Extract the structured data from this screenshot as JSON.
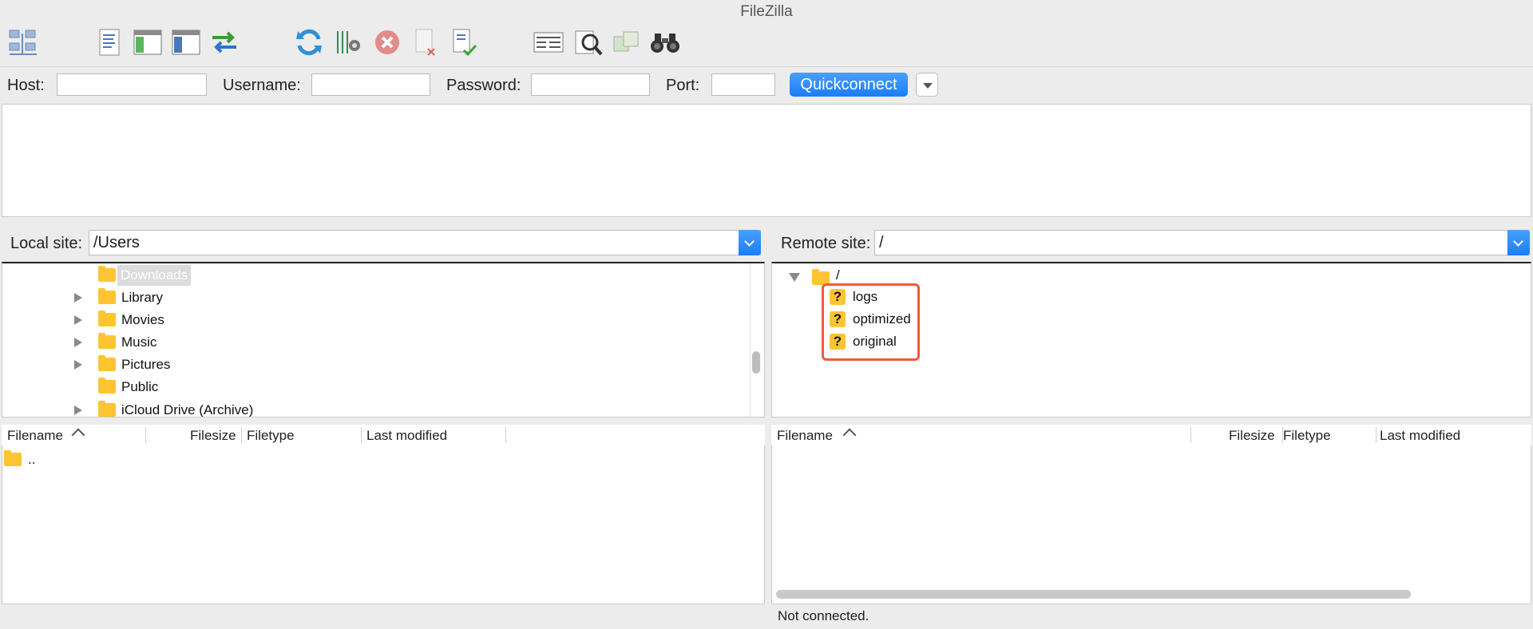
{
  "window": {
    "title": "FileZilla"
  },
  "toolbar": {
    "buttons": [
      {
        "name": "site-manager"
      },
      {
        "name": "toggle-message-log"
      },
      {
        "name": "toggle-local-tree"
      },
      {
        "name": "toggle-remote-tree"
      },
      {
        "name": "toggle-transfer-queue"
      },
      {
        "name": "refresh"
      },
      {
        "name": "process-queue"
      },
      {
        "name": "cancel-operation"
      },
      {
        "name": "disconnect"
      },
      {
        "name": "reconnect"
      },
      {
        "name": "directory-listing-filters"
      },
      {
        "name": "toggle-filename-filters"
      },
      {
        "name": "synchronized-browsing"
      },
      {
        "name": "search-remote-files"
      }
    ]
  },
  "quickconnect": {
    "host_label": "Host:",
    "host_value": "",
    "username_label": "Username:",
    "username_value": "",
    "password_label": "Password:",
    "password_value": "",
    "port_label": "Port:",
    "port_value": "",
    "button_label": "Quickconnect"
  },
  "local": {
    "site_label": "Local site:",
    "site_path": "/Users",
    "tree": [
      {
        "label": "Downloads",
        "expandable": false,
        "selected": true
      },
      {
        "label": "Library",
        "expandable": true
      },
      {
        "label": "Movies",
        "expandable": true
      },
      {
        "label": "Music",
        "expandable": true
      },
      {
        "label": "Pictures",
        "expandable": true
      },
      {
        "label": "Public",
        "expandable": false
      },
      {
        "label": "iCloud Drive (Archive)",
        "expandable": true
      }
    ],
    "columns": {
      "filename": "Filename",
      "filesize": "Filesize",
      "filetype": "Filetype",
      "modified": "Last modified"
    },
    "files": [
      {
        "name": ".."
      }
    ]
  },
  "remote": {
    "site_label": "Remote site:",
    "site_path": "/",
    "tree_root": "/",
    "tree": [
      {
        "label": "logs"
      },
      {
        "label": "optimized"
      },
      {
        "label": "original"
      }
    ],
    "columns": {
      "filename": "Filename",
      "filesize": "Filesize",
      "filetype": "Filetype",
      "modified": "Last modified"
    },
    "status": "Not connected."
  },
  "colors": {
    "accent": "#1a7cf5",
    "folder": "#ffc531",
    "highlight": "#f05a3c"
  }
}
